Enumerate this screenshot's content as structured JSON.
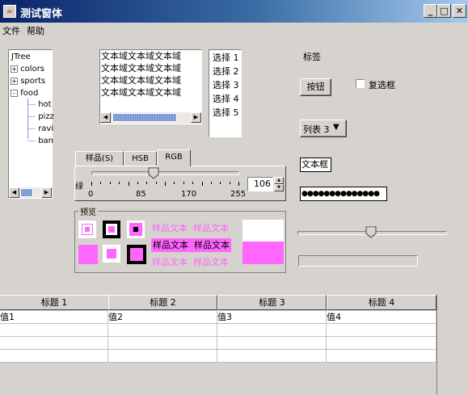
{
  "window": {
    "title": "测试窗体",
    "app_icon": "java-icon",
    "controls": [
      "minimize-icon",
      "maximize-icon",
      "close-icon"
    ]
  },
  "menu": {
    "items": [
      "文件",
      "帮助"
    ]
  },
  "tree": {
    "root": "JTree",
    "nodes": [
      {
        "label": "colors",
        "expander": "+"
      },
      {
        "label": "sports",
        "expander": "+"
      },
      {
        "label": "food",
        "expander": "-"
      }
    ],
    "children": [
      "hot",
      "pizz",
      "ravi",
      "ban"
    ]
  },
  "textarea": {
    "lines": [
      "文本域文本域文本域",
      "文本域文本域文本域",
      "文本域文本域文本域",
      "文本域文本域文本域"
    ]
  },
  "list": {
    "items": [
      "选择 1",
      "选择 2",
      "选择 3",
      "选择 4",
      "选择 5"
    ]
  },
  "label_text": "标签",
  "button_label": "按钮",
  "checkbox": {
    "label": "复选框",
    "checked": false
  },
  "combo": {
    "selected": "列表 3"
  },
  "textfield": {
    "value": "文本框"
  },
  "password": {
    "value": "●●●●●●●●●●●●●●"
  },
  "color_chooser": {
    "tabs": [
      "样品(S)",
      "HSB",
      "RGB"
    ],
    "active_tab": "RGB",
    "channel_label": "绿",
    "value": "106",
    "ticks": [
      "0",
      "85",
      "170",
      "255"
    ],
    "slider_fraction": 0.416,
    "preview_label": "预览",
    "sample_text": "样品文本",
    "sample_color": "#ff66ff"
  },
  "right_slider": {
    "fraction": 0.49
  },
  "table": {
    "headers": [
      "标题 1",
      "标题 2",
      "标题 3",
      "标题 4"
    ],
    "rows": [
      [
        "值1",
        "值2",
        "值3",
        "值4"
      ],
      [
        "",
        "",
        "",
        ""
      ],
      [
        "",
        "",
        "",
        ""
      ],
      [
        "",
        "",
        "",
        ""
      ]
    ]
  }
}
